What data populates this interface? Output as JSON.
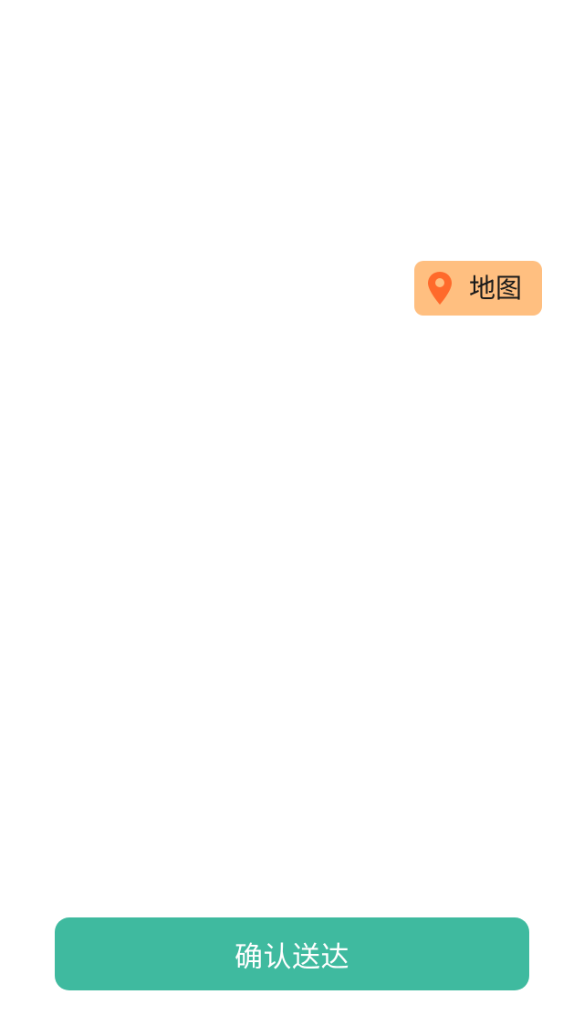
{
  "map_button": {
    "label": "地图",
    "icon": "map-pin-icon",
    "background_color": "#ffbf80",
    "icon_color": "#ff6a2b"
  },
  "confirm_button": {
    "label": "确认送达",
    "background_color": "#3fba9f",
    "text_color": "#ffffff"
  }
}
